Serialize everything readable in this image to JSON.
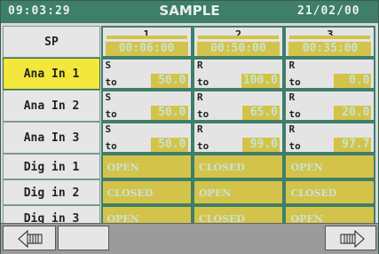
{
  "header": {
    "time": "09:03:29",
    "title": "SAMPLE",
    "date": "21/02/00"
  },
  "sp": {
    "label": "SP",
    "segments": [
      {
        "num": "1",
        "time": "00:06:00"
      },
      {
        "num": "2",
        "time": "00:50:00"
      },
      {
        "num": "3",
        "time": "00:35:00"
      }
    ]
  },
  "analog": [
    {
      "label": "Ana In 1",
      "selected": true,
      "cells": [
        {
          "mode": "S",
          "to": "to",
          "value": "50.0"
        },
        {
          "mode": "R",
          "to": "to",
          "value": "100.0"
        },
        {
          "mode": "R",
          "to": "to",
          "value": "0.0"
        }
      ]
    },
    {
      "label": "Ana In 2",
      "selected": false,
      "cells": [
        {
          "mode": "S",
          "to": "to",
          "value": "50.0"
        },
        {
          "mode": "R",
          "to": "to",
          "value": "65.0"
        },
        {
          "mode": "R",
          "to": "to",
          "value": "20.0"
        }
      ]
    },
    {
      "label": "Ana In 3",
      "selected": false,
      "cells": [
        {
          "mode": "S",
          "to": "to",
          "value": "50.0"
        },
        {
          "mode": "R",
          "to": "to",
          "value": "99.0"
        },
        {
          "mode": "R",
          "to": "to",
          "value": "97.7"
        }
      ]
    }
  ],
  "digital": [
    {
      "label": "Dig in 1",
      "cells": [
        "OPEN",
        "CLOSED",
        "OPEN"
      ]
    },
    {
      "label": "Dig in 2",
      "cells": [
        "CLOSED",
        "OPEN",
        "CLOSED"
      ]
    },
    {
      "label": "Dig in 3",
      "cells": [
        "OPEN",
        "CLOSED",
        "OPEN"
      ]
    }
  ],
  "footer": {
    "left_icon": "scroll-left-icon",
    "right_icon": "scroll-right-icon"
  },
  "colors": {
    "header_bg": "#3f7e69",
    "cell_fill": "#d4c34a",
    "selected_label": "#f2e73a"
  }
}
